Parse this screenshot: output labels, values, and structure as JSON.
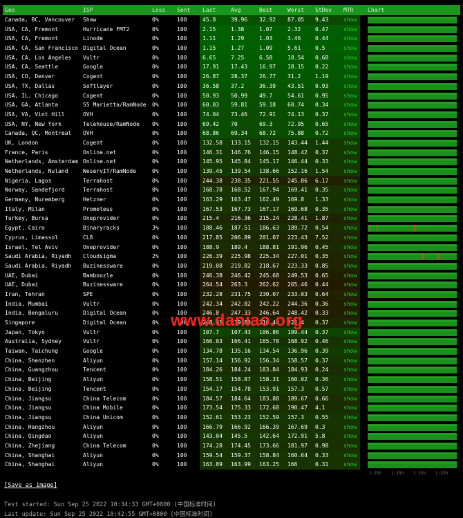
{
  "headers": {
    "geo": "Geo",
    "isp": "ISP",
    "loss": "Loss",
    "sent": "Sent",
    "last": "Last",
    "avg": "Avg",
    "best": "Best",
    "worst": "Worst",
    "stdev": "StDev",
    "mtr": "MTR",
    "chart": "Chart"
  },
  "mtr_label": "show",
  "colors": {
    "header_bg": "#19961b",
    "link": "#27d22a",
    "chart_fill": "#1b8f1b",
    "spike": "#ff3b3b"
  },
  "rows": [
    {
      "geo": "Canada, BC, Vancouver",
      "isp": "Shaw",
      "loss": "0%",
      "sent": "100",
      "last": "45.8",
      "avg": "39.96",
      "best": "32.92",
      "worst": "87.05",
      "stdev": "9.43",
      "spikes": []
    },
    {
      "geo": "USA, CA, Fremont",
      "isp": "Hurricane FMT2",
      "loss": "0%",
      "sent": "100",
      "last": "2.15",
      "avg": "1.38",
      "best": "1.07",
      "worst": "2.32",
      "stdev": "0.47",
      "spikes": []
    },
    {
      "geo": "USA, CA, Fremont",
      "isp": "Linode",
      "loss": "0%",
      "sent": "100",
      "last": "1.11",
      "avg": "1.29",
      "best": "1.03",
      "worst": "3.46",
      "stdev": "0.44",
      "spikes": []
    },
    {
      "geo": "USA, CA, San Francisco",
      "isp": "Digital Ocean",
      "loss": "0%",
      "sent": "100",
      "last": "1.15",
      "avg": "1.27",
      "best": "1.09",
      "worst": "5.61",
      "stdev": "0.5",
      "spikes": []
    },
    {
      "geo": "USA, CA, Los Angeles",
      "isp": "Vultr",
      "loss": "0%",
      "sent": "100",
      "last": "6.65",
      "avg": "7.25",
      "best": "6.58",
      "worst": "18.54",
      "stdev": "0.68",
      "spikes": []
    },
    {
      "geo": "USA, CA, Seattle",
      "isp": "Google",
      "loss": "0%",
      "sent": "100",
      "last": "17.91",
      "avg": "17.43",
      "best": "16.97",
      "worst": "18.15",
      "stdev": "0.22",
      "spikes": []
    },
    {
      "geo": "USA, CO, Denver",
      "isp": "Cogent",
      "loss": "0%",
      "sent": "100",
      "last": "26.87",
      "avg": "28.37",
      "best": "26.77",
      "worst": "31.2",
      "stdev": "1.19",
      "spikes": []
    },
    {
      "geo": "USA, TX, Dallas",
      "isp": "Softlayer",
      "loss": "0%",
      "sent": "100",
      "last": "36.58",
      "avg": "37.2",
      "best": "36.39",
      "worst": "43.51",
      "stdev": "0.93",
      "spikes": []
    },
    {
      "geo": "USA, IL, Chicago",
      "isp": "Cogent",
      "loss": "0%",
      "sent": "100",
      "last": "50.93",
      "avg": "50.99",
      "best": "49.7",
      "worst": "54.61",
      "stdev": "0.95",
      "spikes": []
    },
    {
      "geo": "USA, GA, Atlanta",
      "isp": "55 Marietta/RamNode",
      "loss": "0%",
      "sent": "100",
      "last": "60.03",
      "avg": "59.81",
      "best": "59.18",
      "worst": "60.74",
      "stdev": "0.34",
      "spikes": []
    },
    {
      "geo": "USA, VA, Vint Hill",
      "isp": "OVH",
      "loss": "0%",
      "sent": "100",
      "last": "74.04",
      "avg": "73.46",
      "best": "72.91",
      "worst": "74.13",
      "stdev": "0.37",
      "spikes": []
    },
    {
      "geo": "USA, NY, New York",
      "isp": "Telehouse/RamNode",
      "loss": "0%",
      "sent": "100",
      "last": "69.42",
      "avg": "70",
      "best": "69.3",
      "worst": "72.95",
      "stdev": "0.65",
      "spikes": []
    },
    {
      "geo": "Canada, QC, Montreal",
      "isp": "OVH",
      "loss": "0%",
      "sent": "100",
      "last": "68.86",
      "avg": "69.34",
      "best": "68.72",
      "worst": "75.88",
      "stdev": "0.72",
      "spikes": []
    },
    {
      "geo": "UK, London",
      "isp": "Cogent",
      "loss": "0%",
      "sent": "100",
      "last": "132.58",
      "avg": "133.15",
      "best": "132.15",
      "worst": "143.44",
      "stdev": "1.44",
      "spikes": []
    },
    {
      "geo": "France, Paris",
      "isp": "Online.net",
      "loss": "0%",
      "sent": "100",
      "last": "146.31",
      "avg": "146.76",
      "best": "146.15",
      "worst": "148.42",
      "stdev": "0.37",
      "spikes": []
    },
    {
      "geo": "Netherlands, Amsterdam",
      "isp": "Online.net",
      "loss": "0%",
      "sent": "100",
      "last": "145.95",
      "avg": "145.84",
      "best": "145.17",
      "worst": "146.44",
      "stdev": "0.33",
      "spikes": []
    },
    {
      "geo": "Netherlands, Nuland",
      "isp": "WeservIT/RamNode",
      "loss": "0%",
      "sent": "100",
      "last": "139.45",
      "avg": "139.54",
      "best": "138.66",
      "worst": "152.16",
      "stdev": "1.54",
      "spikes": []
    },
    {
      "geo": "Nigeria, Lagos",
      "isp": "Terrahost",
      "loss": "0%",
      "sent": "100",
      "last": "244.38",
      "avg": "238.35",
      "best": "221.55",
      "worst": "245.86",
      "stdev": "6.17",
      "spikes": []
    },
    {
      "geo": "Norway, Sandefjord",
      "isp": "Terrahost",
      "loss": "0%",
      "sent": "100",
      "last": "168.78",
      "avg": "168.52",
      "best": "167.94",
      "worst": "169.41",
      "stdev": "0.35",
      "spikes": []
    },
    {
      "geo": "Germany, Nuremberg",
      "isp": "Hetzner",
      "loss": "0%",
      "sent": "100",
      "last": "163.29",
      "avg": "163.47",
      "best": "162.49",
      "worst": "169.8",
      "stdev": "1.33",
      "spikes": []
    },
    {
      "geo": "Italy, Milan",
      "isp": "Prometeus",
      "loss": "0%",
      "sent": "100",
      "last": "167.53",
      "avg": "167.73",
      "best": "167.17",
      "worst": "169.68",
      "stdev": "0.35",
      "spikes": []
    },
    {
      "geo": "Turkey, Bursa",
      "isp": "Oneprovider",
      "loss": "0%",
      "sent": "100",
      "last": "215.4",
      "avg": "216.36",
      "best": "215.24",
      "worst": "228.41",
      "stdev": "1.87",
      "spikes": []
    },
    {
      "geo": "Egypt, Cairo",
      "isp": "Binaryracks",
      "loss": "3%",
      "sent": "100",
      "last": "188.46",
      "avg": "187.51",
      "best": "186.63",
      "worst": "189.72",
      "stdev": "0.54",
      "spikes": [
        3,
        14,
        68
      ]
    },
    {
      "geo": "Cyprus, Limassol",
      "isp": "CL8",
      "loss": "0%",
      "sent": "100",
      "last": "217.85",
      "avg": "206.89",
      "best": "201.07",
      "worst": "223.43",
      "stdev": "7.52",
      "spikes": []
    },
    {
      "geo": "Israel, Tel Aviv",
      "isp": "Oneprovider",
      "loss": "0%",
      "sent": "100",
      "last": "188.9",
      "avg": "189.4",
      "best": "188.81",
      "worst": "191.96",
      "stdev": "0.45",
      "spikes": []
    },
    {
      "geo": "Saudi Arabia, Riyadh",
      "isp": "Cloudsigma",
      "loss": "2%",
      "sent": "100",
      "last": "226.39",
      "avg": "225.98",
      "best": "225.34",
      "worst": "227.01",
      "stdev": "0.35",
      "spikes": [
        80,
        102
      ]
    },
    {
      "geo": "Saudi Arabia, Riyadh",
      "isp": "Buzinessware",
      "loss": "0%",
      "sent": "100",
      "last": "219.08",
      "avg": "219.82",
      "best": "218.67",
      "worst": "223.33",
      "stdev": "0.85",
      "spikes": []
    },
    {
      "geo": "UAE, Dubai",
      "isp": "Bamboozle",
      "loss": "0%",
      "sent": "100",
      "last": "246.38",
      "avg": "246.42",
      "best": "245.68",
      "worst": "249.53",
      "stdev": "0.65",
      "spikes": []
    },
    {
      "geo": "UAE, Dubai",
      "isp": "Buzinessware",
      "loss": "0%",
      "sent": "100",
      "last": "264.54",
      "avg": "263.3",
      "best": "262.62",
      "worst": "265.46",
      "stdev": "0.44",
      "spikes": []
    },
    {
      "geo": "Iran, Tehran",
      "isp": "SPE",
      "loss": "0%",
      "sent": "100",
      "last": "232.28",
      "avg": "231.75",
      "best": "230.07",
      "worst": "233.03",
      "stdev": "0.64",
      "spikes": []
    },
    {
      "geo": "India, Mumbai",
      "isp": "Vultr",
      "loss": "0%",
      "sent": "100",
      "last": "242.34",
      "avg": "242.82",
      "best": "242.22",
      "worst": "244.36",
      "stdev": "0.36",
      "spikes": []
    },
    {
      "geo": "India, Bengaluru",
      "isp": "Digital Ocean",
      "loss": "0%",
      "sent": "100",
      "last": "246.8",
      "avg": "247.33",
      "best": "246.64",
      "worst": "248.42",
      "stdev": "0.33",
      "spikes": []
    },
    {
      "geo": "Singapore",
      "isp": "Digital Ocean",
      "loss": "0%",
      "sent": "100",
      "last": "248.81",
      "avg": "219.83",
      "best": "218.48",
      "worst": "221.4",
      "stdev": "0.37",
      "spikes": []
    },
    {
      "geo": "Japan, Tokyo",
      "isp": "Vultr",
      "loss": "0%",
      "sent": "100",
      "last": "107.7",
      "avg": "107.43",
      "best": "106.86",
      "worst": "109.44",
      "stdev": "0.37",
      "spikes": []
    },
    {
      "geo": "Australia, Sydney",
      "isp": "Vultr",
      "loss": "0%",
      "sent": "100",
      "last": "166.03",
      "avg": "166.41",
      "best": "165.78",
      "worst": "168.92",
      "stdev": "0.46",
      "spikes": []
    },
    {
      "geo": "Taiwan, Taichung",
      "isp": "Google",
      "loss": "0%",
      "sent": "100",
      "last": "134.78",
      "avg": "135.16",
      "best": "134.54",
      "worst": "136.96",
      "stdev": "0.39",
      "spikes": []
    },
    {
      "geo": "China, Shenzhen",
      "isp": "Aliyun",
      "loss": "0%",
      "sent": "100",
      "last": "157.14",
      "avg": "156.92",
      "best": "156.34",
      "worst": "158.57",
      "stdev": "0.37",
      "spikes": []
    },
    {
      "geo": "China, Guangzhou",
      "isp": "Tencent",
      "loss": "0%",
      "sent": "100",
      "last": "184.26",
      "avg": "184.24",
      "best": "183.84",
      "worst": "184.93",
      "stdev": "0.24",
      "spikes": []
    },
    {
      "geo": "China, Beijing",
      "isp": "Aliyun",
      "loss": "0%",
      "sent": "100",
      "last": "158.51",
      "avg": "158.87",
      "best": "158.31",
      "worst": "160.02",
      "stdev": "0.36",
      "spikes": []
    },
    {
      "geo": "China, Beijing",
      "isp": "Tencent",
      "loss": "0%",
      "sent": "100",
      "last": "154.17",
      "avg": "154.78",
      "best": "153.91",
      "worst": "157.3",
      "stdev": "0.57",
      "spikes": []
    },
    {
      "geo": "China, Jiangsu",
      "isp": "China Telecom",
      "loss": "0%",
      "sent": "100",
      "last": "184.57",
      "avg": "184.64",
      "best": "183.88",
      "worst": "189.67",
      "stdev": "0.66",
      "spikes": []
    },
    {
      "geo": "China, Jiangsu",
      "isp": "China Mobile",
      "loss": "0%",
      "sent": "100",
      "last": "173.54",
      "avg": "175.33",
      "best": "172.68",
      "worst": "190.47",
      "stdev": "4.1",
      "spikes": []
    },
    {
      "geo": "China, Jiangsu",
      "isp": "China Unicom",
      "loss": "0%",
      "sent": "100",
      "last": "152.61",
      "avg": "153.23",
      "best": "152.59",
      "worst": "157.3",
      "stdev": "0.55",
      "spikes": []
    },
    {
      "geo": "China, Hangzhou",
      "isp": "Aliyun",
      "loss": "0%",
      "sent": "100",
      "last": "166.79",
      "avg": "166.92",
      "best": "166.39",
      "worst": "167.69",
      "stdev": "0.3",
      "spikes": []
    },
    {
      "geo": "China, Qingdao",
      "isp": "Aliyun",
      "loss": "0%",
      "sent": "100",
      "last": "143.04",
      "avg": "145.5",
      "best": "142.64",
      "worst": "172.91",
      "stdev": "5.8",
      "spikes": []
    },
    {
      "geo": "China, Zhejiang",
      "isp": "China Telecom",
      "loss": "0%",
      "sent": "100",
      "last": "174.28",
      "avg": "174.45",
      "best": "173.66",
      "worst": "181.97",
      "stdev": "0.98",
      "spikes": []
    },
    {
      "geo": "China, Shanghai",
      "isp": "Aliyun",
      "loss": "0%",
      "sent": "100",
      "last": "159.54",
      "avg": "159.37",
      "best": "158.84",
      "worst": "160.64",
      "stdev": "0.33",
      "spikes": []
    },
    {
      "geo": "China, Shanghai",
      "isp": "Aliyun",
      "loss": "0%",
      "sent": "100",
      "last": "163.89",
      "avg": "163.99",
      "best": "163.25",
      "worst": "166",
      "stdev": "0.31",
      "spikes": []
    }
  ],
  "axis_ticks": [
    "1:25h",
    "1:25h",
    "1:25h",
    "1:25h"
  ],
  "save_label": "Save as image",
  "test_started": "Test started: Sun Sep 25 2022 10:34:33 GMT+0800 (中国标准时间)",
  "last_update": "Last update: Sun Sep 25 2022 10:42:55 GMT+0800 (中国标准时间)",
  "watermark": "www.daniao.org"
}
